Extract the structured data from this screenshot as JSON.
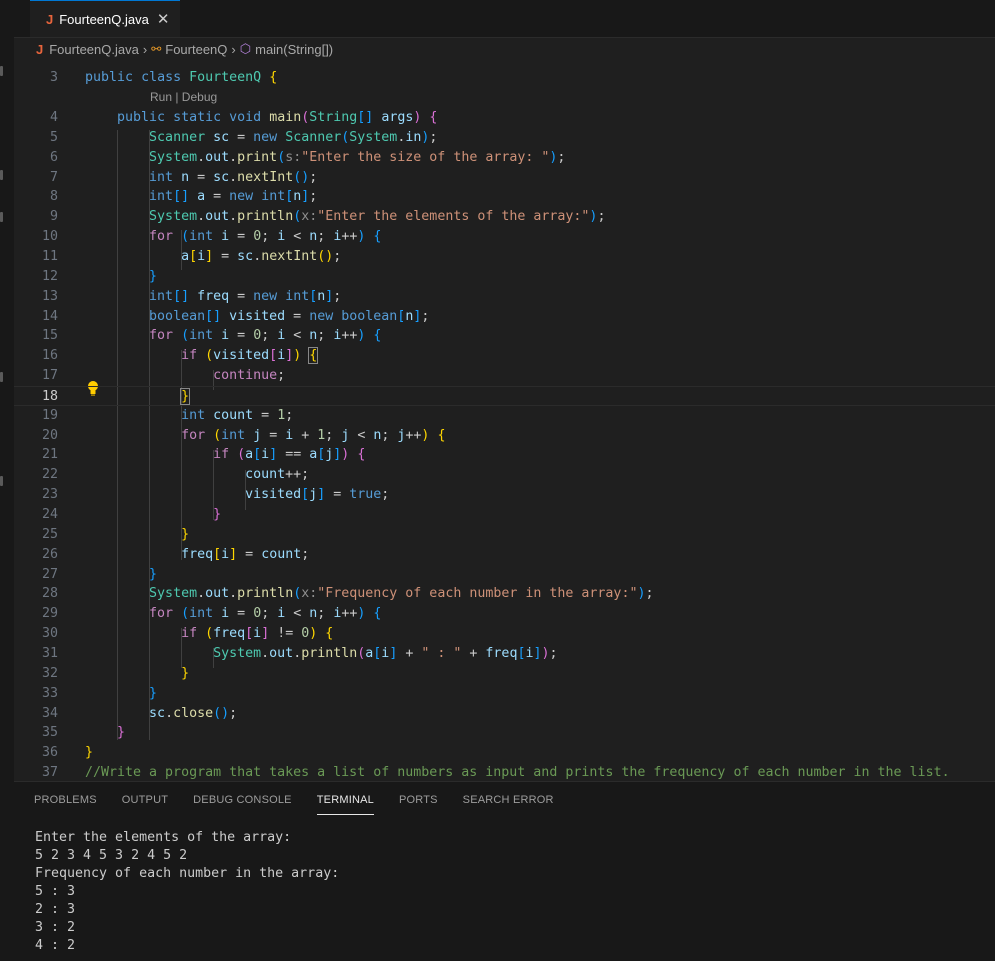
{
  "tab": {
    "icon_letter": "J",
    "filename": "FourteenQ.java",
    "close_glyph": "✕"
  },
  "breadcrumb": {
    "file": "FourteenQ.java",
    "class": "FourteenQ",
    "method": "main(String[])"
  },
  "codelens": "Run | Debug",
  "editor": {
    "active_line": 18,
    "lines": [
      {
        "n": "3",
        "html": "<span class=\"kw\">public</span> <span class=\"kw\">class</span> <span class=\"ty\">FourteenQ</span> <span class=\"b1\">{</span>"
      },
      {
        "n": "4",
        "html": "    <span class=\"kw\">public</span> <span class=\"kw\">static</span> <span class=\"kw\">void</span> <span class=\"fn\">main</span><span class=\"b2\">(</span><span class=\"ty\">String</span><span class=\"b3\">[]</span> <span class=\"v\">args</span><span class=\"b2\">)</span> <span class=\"b2\">{</span>"
      },
      {
        "n": "5",
        "html": "        <span class=\"ty\">Scanner</span> <span class=\"v\">sc</span> = <span class=\"kw\">new</span> <span class=\"ty\">Scanner</span><span class=\"b3\">(</span><span class=\"ty\">System</span>.<span class=\"v\">in</span><span class=\"b3\">)</span>;"
      },
      {
        "n": "6",
        "html": "        <span class=\"ty\">System</span>.<span class=\"v\">out</span>.<span class=\"fn\">print</span><span class=\"b3\">(</span><span class=\"hint\">s:</span><span class=\"str\">\"Enter the size of the array: \"</span><span class=\"b3\">)</span>;"
      },
      {
        "n": "7",
        "html": "        <span class=\"kw\">int</span> <span class=\"v\">n</span> = <span class=\"v\">sc</span>.<span class=\"fn\">nextInt</span><span class=\"b3\">()</span>;"
      },
      {
        "n": "8",
        "html": "        <span class=\"kw\">int</span><span class=\"b3\">[]</span> <span class=\"v\">a</span> = <span class=\"kw\">new</span> <span class=\"kw\">int</span><span class=\"b3\">[</span><span class=\"v\">n</span><span class=\"b3\">]</span>;"
      },
      {
        "n": "9",
        "html": "        <span class=\"ty\">System</span>.<span class=\"v\">out</span>.<span class=\"fn\">println</span><span class=\"b3\">(</span><span class=\"hint\">x:</span><span class=\"str\">\"Enter the elements of the array:\"</span><span class=\"b3\">)</span>;"
      },
      {
        "n": "10",
        "html": "        <span class=\"kw2\">for</span> <span class=\"b3\">(</span><span class=\"kw\">int</span> <span class=\"v\">i</span> = <span class=\"num\">0</span>; <span class=\"v\">i</span> &lt; <span class=\"v\">n</span>; <span class=\"v\">i</span>++<span class=\"b3\">)</span> <span class=\"b3\">{</span>"
      },
      {
        "n": "11",
        "html": "            <span class=\"v\">a</span><span class=\"b1\">[</span><span class=\"v\">i</span><span class=\"b1\">]</span> = <span class=\"v\">sc</span>.<span class=\"fn\">nextInt</span><span class=\"b1\">()</span>;"
      },
      {
        "n": "12",
        "html": "        <span class=\"b3\">}</span>"
      },
      {
        "n": "13",
        "html": "        <span class=\"kw\">int</span><span class=\"b3\">[]</span> <span class=\"v\">freq</span> = <span class=\"kw\">new</span> <span class=\"kw\">int</span><span class=\"b3\">[</span><span class=\"v\">n</span><span class=\"b3\">]</span>;"
      },
      {
        "n": "14",
        "html": "        <span class=\"kw\">boolean</span><span class=\"b3\">[]</span> <span class=\"v\">visited</span> = <span class=\"kw\">new</span> <span class=\"kw\">boolean</span><span class=\"b3\">[</span><span class=\"v\">n</span><span class=\"b3\">]</span>;"
      },
      {
        "n": "15",
        "html": "        <span class=\"kw2\">for</span> <span class=\"b3\">(</span><span class=\"kw\">int</span> <span class=\"v\">i</span> = <span class=\"num\">0</span>; <span class=\"v\">i</span> &lt; <span class=\"v\">n</span>; <span class=\"v\">i</span>++<span class=\"b3\">)</span> <span class=\"b3\">{</span>"
      },
      {
        "n": "16",
        "html": "            <span class=\"kw2\">if</span> <span class=\"b1\">(</span><span class=\"v\">visited</span><span class=\"b2\">[</span><span class=\"v\">i</span><span class=\"b2\">]</span><span class=\"b1\">)</span> <span class=\"b1\" style=\"outline:1px solid #888;\">{</span>"
      },
      {
        "n": "17",
        "html": "                <span class=\"kw2\">continue</span>;"
      },
      {
        "n": "18",
        "html": "            <span class=\"b1\" style=\"outline:1px solid #888;\">}</span>"
      },
      {
        "n": "19",
        "html": "            <span class=\"kw\">int</span> <span class=\"v\">count</span> = <span class=\"num\">1</span>;"
      },
      {
        "n": "20",
        "html": "            <span class=\"kw2\">for</span> <span class=\"b1\">(</span><span class=\"kw\">int</span> <span class=\"v\">j</span> = <span class=\"v\">i</span> + <span class=\"num\">1</span>; <span class=\"v\">j</span> &lt; <span class=\"v\">n</span>; <span class=\"v\">j</span>++<span class=\"b1\">)</span> <span class=\"b1\">{</span>"
      },
      {
        "n": "21",
        "html": "                <span class=\"kw2\">if</span> <span class=\"b2\">(</span><span class=\"v\">a</span><span class=\"b3\">[</span><span class=\"v\">i</span><span class=\"b3\">]</span> == <span class=\"v\">a</span><span class=\"b3\">[</span><span class=\"v\">j</span><span class=\"b3\">]</span><span class=\"b2\">)</span> <span class=\"b2\">{</span>"
      },
      {
        "n": "22",
        "html": "                    <span class=\"v\">count</span>++;"
      },
      {
        "n": "23",
        "html": "                    <span class=\"v\">visited</span><span class=\"b3\">[</span><span class=\"v\">j</span><span class=\"b3\">]</span> = <span class=\"kw\">true</span>;"
      },
      {
        "n": "24",
        "html": "                <span class=\"b2\">}</span>"
      },
      {
        "n": "25",
        "html": "            <span class=\"b1\">}</span>"
      },
      {
        "n": "26",
        "html": "            <span class=\"v\">freq</span><span class=\"b1\">[</span><span class=\"v\">i</span><span class=\"b1\">]</span> = <span class=\"v\">count</span>;"
      },
      {
        "n": "27",
        "html": "        <span class=\"b3\">}</span>"
      },
      {
        "n": "28",
        "html": "        <span class=\"ty\">System</span>.<span class=\"v\">out</span>.<span class=\"fn\">println</span><span class=\"b3\">(</span><span class=\"hint\">x:</span><span class=\"str\">\"Frequency of each number in the array:\"</span><span class=\"b3\">)</span>;"
      },
      {
        "n": "29",
        "html": "        <span class=\"kw2\">for</span> <span class=\"b3\">(</span><span class=\"kw\">int</span> <span class=\"v\">i</span> = <span class=\"num\">0</span>; <span class=\"v\">i</span> &lt; <span class=\"v\">n</span>; <span class=\"v\">i</span>++<span class=\"b3\">)</span> <span class=\"b3\">{</span>"
      },
      {
        "n": "30",
        "html": "            <span class=\"kw2\">if</span> <span class=\"b1\">(</span><span class=\"v\">freq</span><span class=\"b2\">[</span><span class=\"v\">i</span><span class=\"b2\">]</span> != <span class=\"num\">0</span><span class=\"b1\">)</span> <span class=\"b1\">{</span>"
      },
      {
        "n": "31",
        "html": "                <span class=\"ty\">System</span>.<span class=\"v\">out</span>.<span class=\"fn\">println</span><span class=\"b2\">(</span><span class=\"v\">a</span><span class=\"b3\">[</span><span class=\"v\">i</span><span class=\"b3\">]</span> + <span class=\"str\">\" : \"</span> + <span class=\"v\">freq</span><span class=\"b3\">[</span><span class=\"v\">i</span><span class=\"b3\">]</span><span class=\"b2\">)</span>;"
      },
      {
        "n": "32",
        "html": "            <span class=\"b1\">}</span>"
      },
      {
        "n": "33",
        "html": "        <span class=\"b3\">}</span>"
      },
      {
        "n": "34",
        "html": "        <span class=\"v\">sc</span>.<span class=\"fn\">close</span><span class=\"b3\">()</span>;"
      },
      {
        "n": "35",
        "html": "    <span class=\"b2\">}</span>"
      },
      {
        "n": "36",
        "html": "<span class=\"b1\">}</span>"
      },
      {
        "n": "37",
        "html": "<span class=\"cm\">//Write a program that takes a list of numbers as input and prints the frequency of each number in the list.</span>"
      }
    ]
  },
  "panel": {
    "tabs": [
      "PROBLEMS",
      "OUTPUT",
      "DEBUG CONSOLE",
      "TERMINAL",
      "PORTS",
      "SEARCH ERROR"
    ],
    "active_tab": "TERMINAL",
    "terminal_lines": [
      "Enter the elements of the array:",
      "5 2 3 4 5 3 2 4 5 2",
      "Frequency of each number in the array:",
      "5 : 3",
      "2 : 3",
      "3 : 2",
      "4 : 2"
    ]
  }
}
